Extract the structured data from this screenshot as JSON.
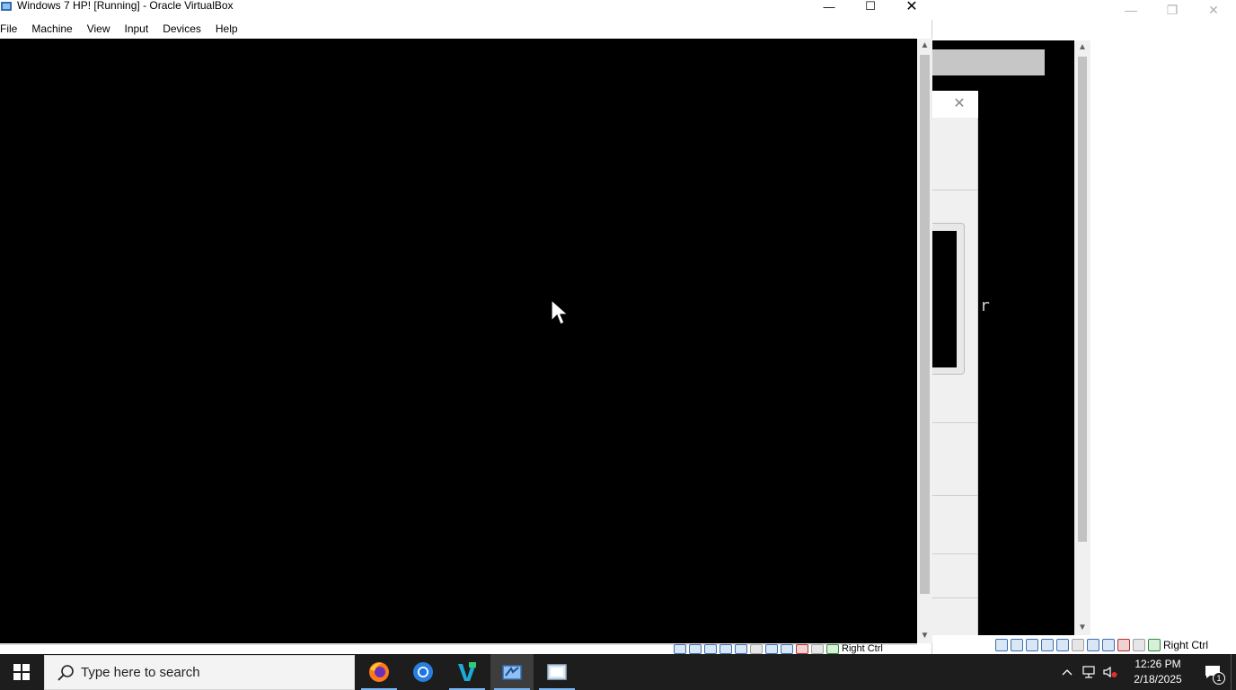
{
  "main_window": {
    "title": "Windows 7 HP! [Running] - Oracle VirtualBox",
    "menu": [
      "File",
      "Machine",
      "View",
      "Input",
      "Devices",
      "Help"
    ],
    "controls": {
      "minimize": "—",
      "maximize": "☐",
      "close": "✕"
    },
    "status_host_key": "Right Ctrl"
  },
  "background_window": {
    "controls": {
      "minimize": "—",
      "restore": "❐",
      "close": "✕"
    },
    "dialog_close": "✕",
    "console_char": "r",
    "status_host_key": "Right Ctrl"
  },
  "taskbar": {
    "search_placeholder": "Type here to search",
    "apps": [
      "firefox-icon",
      "chrome-icon",
      "vscode-icon",
      "virtualbox-icon",
      "virtualbox-manager-icon"
    ],
    "clock_time": "12:26 PM",
    "clock_date": "2/18/2025",
    "notification_count": "1"
  },
  "colors": {
    "vm_display": "#000000",
    "taskbar": "#1d1d1d",
    "accent": "#78b4f0"
  }
}
